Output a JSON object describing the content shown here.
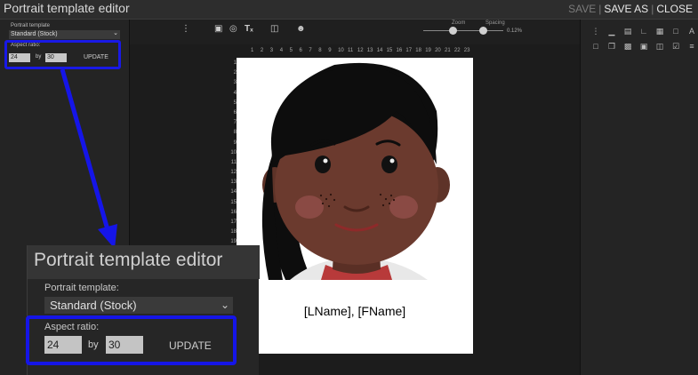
{
  "app": {
    "title": "Portrait template editor",
    "actions": {
      "save": "SAVE",
      "save_as": "SAVE AS",
      "close": "CLOSE"
    }
  },
  "left_panel": {
    "template_label": "Portrait template",
    "template_value": "Standard (Stock)",
    "aspect_label": "Aspect ratio:",
    "width_value": "24",
    "by_label": "by",
    "height_value": "30",
    "update_label": "UPDATE"
  },
  "toolbar": {
    "zoom_label": "Zoom",
    "spacing_label": "Spacing",
    "spacing_value": "0.12%",
    "zoom_level": 0.55,
    "spacing_level": 0.1
  },
  "ruler": {
    "top": [
      "1",
      "2",
      "3",
      "4",
      "5",
      "6",
      "7",
      "8",
      "9",
      "10",
      "11",
      "12",
      "13",
      "14",
      "15",
      "16",
      "17",
      "18",
      "19",
      "20",
      "21",
      "22",
      "23"
    ],
    "left": [
      "1",
      "2",
      "3",
      "4",
      "5",
      "6",
      "7",
      "8",
      "9",
      "10",
      "11",
      "12",
      "13",
      "14",
      "15",
      "16",
      "17",
      "18",
      "19"
    ]
  },
  "card": {
    "name_text": "[LName], [FName]"
  },
  "zoom_callout": {
    "title": "Portrait template editor",
    "template_label": "Portrait template:",
    "template_value": "Standard (Stock)",
    "aspect_label": "Aspect ratio:",
    "width_value": "24",
    "by_label": "by",
    "height_value": "30",
    "update_label": "UPDATE"
  },
  "colors": {
    "highlight": "#1515e8",
    "hair": "#0d0d0d",
    "skin": "#6b3a2e",
    "blush": "#8a4a44",
    "shirt": "#b83a3a"
  },
  "icons": {
    "toolbar": [
      "more-vertical-icon",
      "image-icon",
      "circle-icon",
      "text-icon",
      "barcode-icon",
      "person-icon"
    ],
    "right_panel": [
      "grid-icon",
      "line-icon",
      "layers-icon",
      "chart-icon",
      "table-icon",
      "field-icon",
      "font-icon",
      "align-icon",
      "page-icon",
      "copy-icon",
      "folder-icon",
      "image-icon",
      "database-icon",
      "checkbox-icon",
      "paint-icon",
      "sliders-icon"
    ]
  }
}
